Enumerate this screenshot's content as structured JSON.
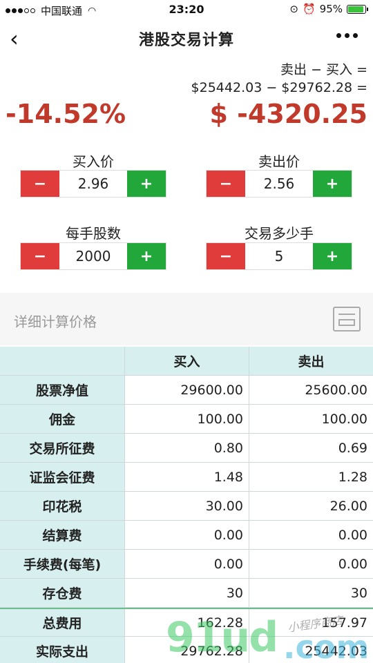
{
  "status": {
    "carrier": "中国联通",
    "time": "23:20",
    "battery": "95%",
    "battery_level": 0.95
  },
  "nav": {
    "title": "港股交易计算"
  },
  "summary": {
    "formula_line1": "卖出 − 买入 =",
    "formula_line2": "$25442.03 − $29762.28 =",
    "percent": "-14.52%",
    "profit": "$ -4320.25"
  },
  "inputs": {
    "buy_price": {
      "label": "买入价",
      "value": "2.96"
    },
    "sell_price": {
      "label": "卖出价",
      "value": "2.56"
    },
    "lot_size": {
      "label": "每手股数",
      "value": "2000"
    },
    "lots": {
      "label": "交易多少手",
      "value": "5"
    },
    "minus": "−",
    "plus": "+"
  },
  "details": {
    "title": "详细计算价格",
    "columns": [
      "",
      "买入",
      "卖出"
    ],
    "rows": [
      {
        "name": "股票净值",
        "buy": "29600.00",
        "sell": "25600.00"
      },
      {
        "name": "佣金",
        "buy": "100.00",
        "sell": "100.00"
      },
      {
        "name": "交易所征费",
        "buy": "0.80",
        "sell": "0.69"
      },
      {
        "name": "证监会征费",
        "buy": "1.48",
        "sell": "1.28"
      },
      {
        "name": "印花税",
        "buy": "30.00",
        "sell": "26.00"
      },
      {
        "name": "结算费",
        "buy": "0.00",
        "sell": "0.00"
      },
      {
        "name": "手续费(每笔)",
        "buy": "0.00",
        "sell": "0.00"
      },
      {
        "name": "存仓费",
        "buy": "30",
        "sell": "30"
      },
      {
        "name": "总费用",
        "buy": "162.28",
        "sell": "157.97"
      },
      {
        "name": "实际支出",
        "buy": "29762.28",
        "sell": "25442.03"
      }
    ]
  },
  "watermark": {
    "main": "91ud",
    "suffix": ".com",
    "script": "小程序商店"
  }
}
